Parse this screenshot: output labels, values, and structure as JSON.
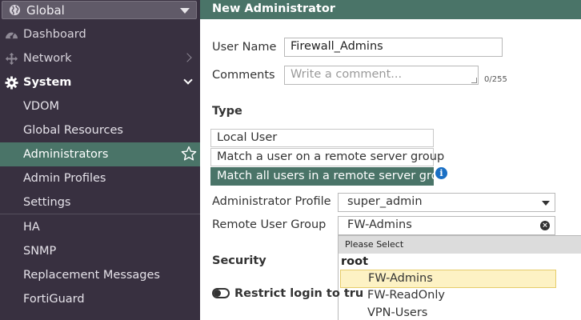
{
  "sidebar": {
    "vdom": "Global",
    "items": [
      {
        "label": "Dashboard"
      },
      {
        "label": "Network"
      },
      {
        "label": "System"
      },
      {
        "label": "VDOM"
      },
      {
        "label": "Global Resources"
      },
      {
        "label": "Administrators"
      },
      {
        "label": "Admin Profiles"
      },
      {
        "label": "Settings"
      },
      {
        "label": "HA"
      },
      {
        "label": "SNMP"
      },
      {
        "label": "Replacement Messages"
      },
      {
        "label": "FortiGuard"
      }
    ]
  },
  "header": {
    "title": "New Administrator"
  },
  "form": {
    "user_name_label": "User Name",
    "user_name_value": "Firewall_Admins",
    "comments_label": "Comments",
    "comments_placeholder": "Write a comment...",
    "comments_counter": "0/255",
    "type_label": "Type",
    "type_options": [
      {
        "label": "Local User"
      },
      {
        "label": "Match a user on a remote server group"
      },
      {
        "label": "Match all users in a remote server group"
      }
    ],
    "admin_profile_label": "Administrator Profile",
    "admin_profile_value": "super_admin",
    "remote_group_label": "Remote User Group",
    "remote_group_value": "FW-Admins",
    "security_label": "Security",
    "restrict_label": "Restrict login to tru"
  },
  "dropdown": {
    "header": "Please Select",
    "group": "root",
    "items": [
      {
        "label": "FW-Admins"
      },
      {
        "label": "FW-ReadOnly"
      },
      {
        "label": "VPN-Users"
      }
    ]
  }
}
